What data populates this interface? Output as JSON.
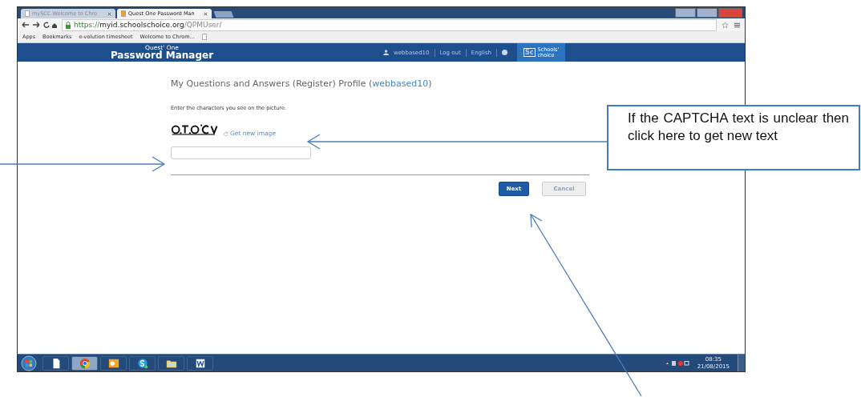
{
  "browser": {
    "tabs": [
      {
        "label": "mySCC Welcome to Chro",
        "selected": false
      },
      {
        "label": "Quest One Password Man",
        "selected": true
      }
    ],
    "address": {
      "scheme": "https://",
      "host": "myid.schoolschoice.org",
      "path": "/QPMUser/"
    },
    "bookmarks": [
      "Apps",
      "Bookmarks",
      "e-volution timesheet",
      "Welcome to Chrom..."
    ]
  },
  "header": {
    "product_small": "Quest' One",
    "product": "Password Manager",
    "user": "webbased10",
    "links": [
      "Log out",
      "English"
    ],
    "logo_mark": "Sc",
    "logo_lines": [
      "Schools'",
      "choice"
    ]
  },
  "content": {
    "title": "My Questions and Answers (Register) Profile (",
    "title_user": "webbased10",
    "title_end": ")",
    "instruction": "Enter the characters you see on the picture.",
    "refresh_link": "Get new image",
    "buttons": [
      {
        "label": "Next",
        "disabled": false
      },
      {
        "label": "Cancel",
        "disabled": true
      }
    ]
  },
  "taskbar": {
    "apps": [
      {
        "kind": "document",
        "selected": false
      },
      {
        "kind": "browser",
        "selected": true
      },
      {
        "kind": "mail",
        "selected": false
      },
      {
        "kind": "chat",
        "selected": false
      },
      {
        "kind": "folder",
        "selected": false
      },
      {
        "kind": "word",
        "selected": false
      }
    ],
    "time": "08:35",
    "date": "21/08/2015"
  },
  "annotation": {
    "callout": "If the CAPTCHA text is unclear then click here to get new text"
  }
}
